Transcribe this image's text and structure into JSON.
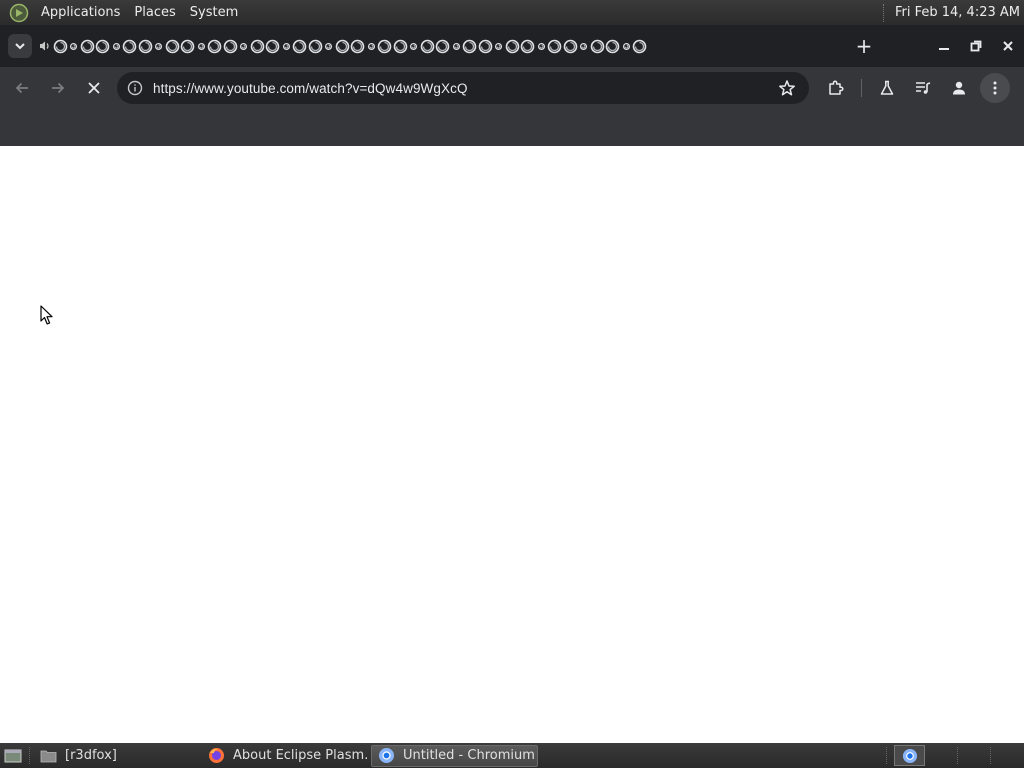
{
  "top_panel": {
    "menus": [
      "Applications",
      "Places",
      "System"
    ],
    "clock": "Fri Feb 14,  4:23 AM"
  },
  "browser": {
    "tab_count_visible": 42,
    "new_tab_label": "+",
    "omnibox": {
      "url": "https://www.youtube.com/watch?v=dQw4w9WgXcQ"
    },
    "colors": {
      "tabstrip": "#202124",
      "toolbar": "#35363a",
      "omnibox": "#202124",
      "icon": "#c4c7c5"
    }
  },
  "taskbar": {
    "items": [
      {
        "label": "[r3dfox]",
        "icon": "folder-icon",
        "active": false
      },
      {
        "label": "About Eclipse Plasm…",
        "icon": "firefox-icon",
        "active": false
      },
      {
        "label": "Untitled - Chromium",
        "icon": "chromium-icon",
        "active": true
      }
    ]
  }
}
